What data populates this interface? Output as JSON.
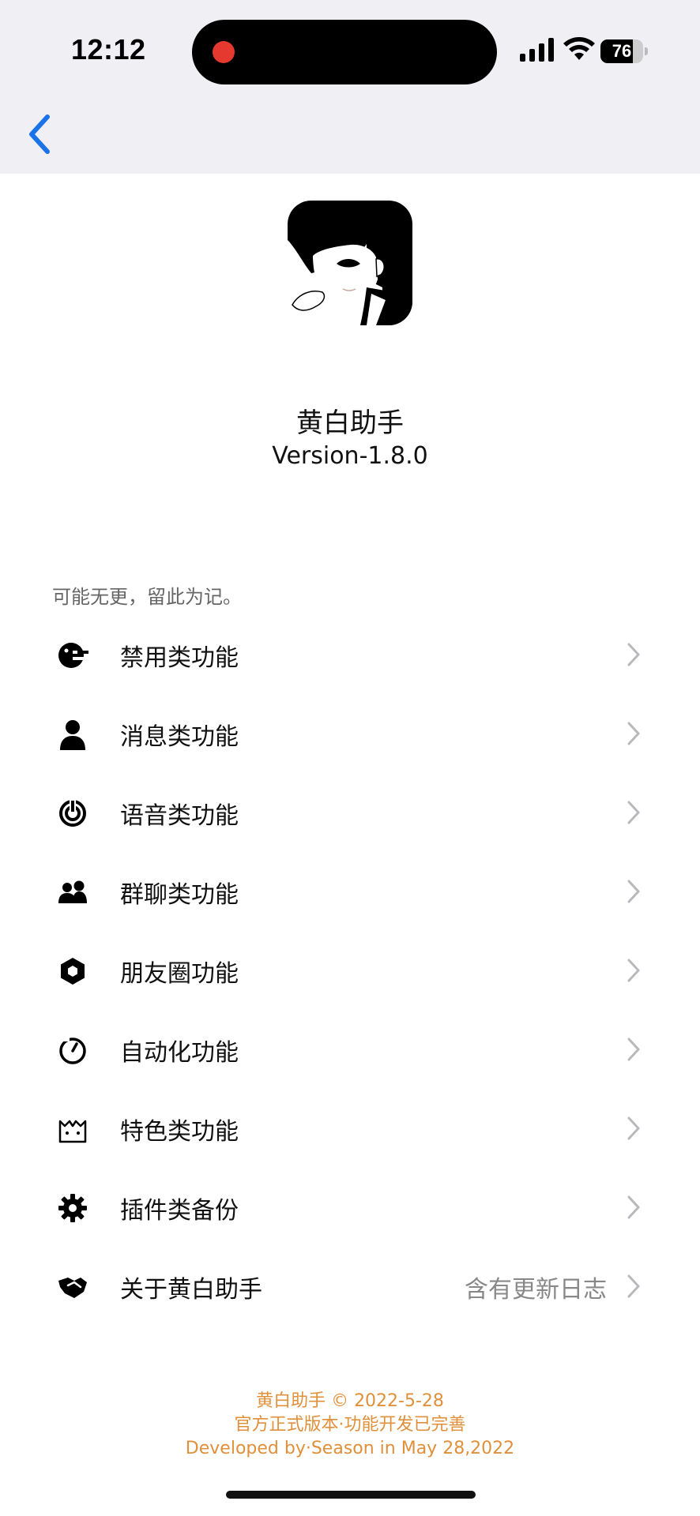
{
  "status_bar": {
    "time": "12:12",
    "battery": "76",
    "battery_level_percent": 76,
    "recording_color": "#e5392f"
  },
  "app": {
    "name": "黄白助手",
    "version": "Version-1.8.0"
  },
  "note": "可能无更，留此为记。",
  "menu": {
    "items": [
      {
        "label": "禁用类功能",
        "icon": "ban-face-icon",
        "detail": ""
      },
      {
        "label": "消息类功能",
        "icon": "person-icon",
        "detail": ""
      },
      {
        "label": "语音类功能",
        "icon": "voice-icon",
        "detail": ""
      },
      {
        "label": "群聊类功能",
        "icon": "group-icon",
        "detail": ""
      },
      {
        "label": "朋友圈功能",
        "icon": "aperture-icon",
        "detail": ""
      },
      {
        "label": "自动化功能",
        "icon": "timer-icon",
        "detail": ""
      },
      {
        "label": "特色类功能",
        "icon": "cat-icon",
        "detail": ""
      },
      {
        "label": "插件类备份",
        "icon": "gear-icon",
        "detail": ""
      },
      {
        "label": "关于黄白助手",
        "icon": "handshake-icon",
        "detail": "含有更新日志"
      }
    ]
  },
  "footer": {
    "line1": "黄白助手 © 2022-5-28",
    "line2": "官方正式版本·功能开发已完善",
    "line3": "Developed by·Season in May 28,2022",
    "color": "#e0903a"
  },
  "colors": {
    "accent": "#1a73e8",
    "header_bg": "#efeff4"
  }
}
